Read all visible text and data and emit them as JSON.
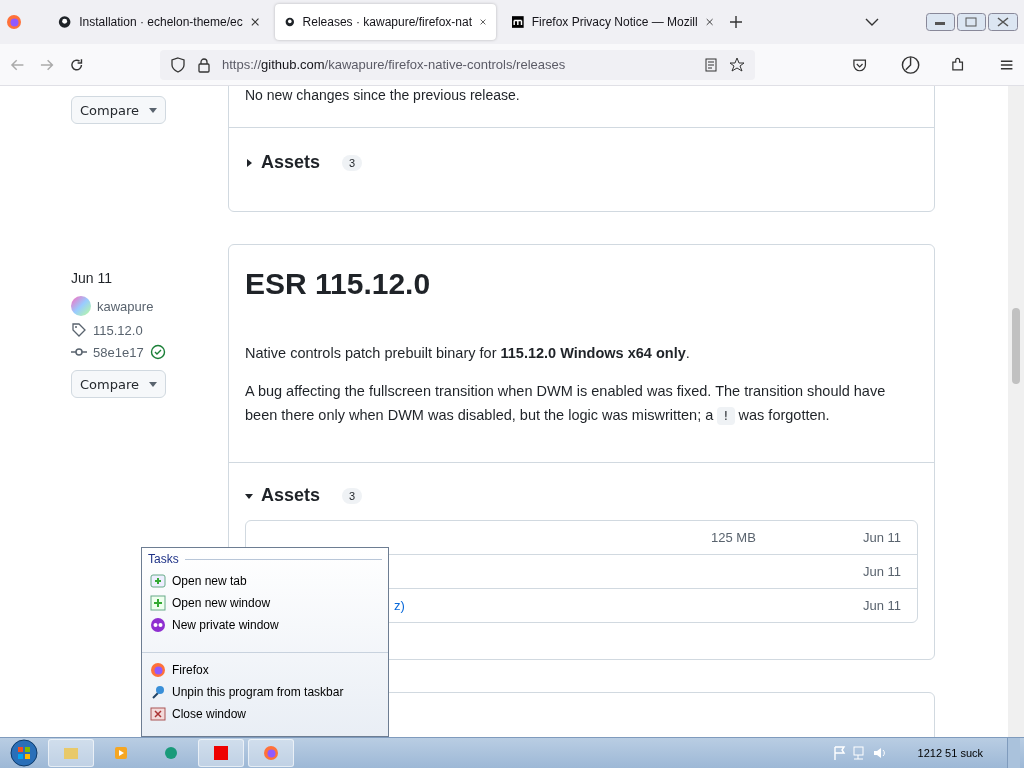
{
  "browser": {
    "tabs": [
      {
        "title": "Installation · echelon-theme/ec",
        "selected": false
      },
      {
        "title": "Releases · kawapure/firefox-nat",
        "selected": true
      },
      {
        "title": "Firefox Privacy Notice — Mozill",
        "selected": false
      }
    ],
    "url_prefix": "https://",
    "url_host": "github.com",
    "url_path": "/kawapure/firefox-native-controls/releases"
  },
  "releases": [
    {
      "compare": "Compare",
      "notes": "No new changes since the previous release.",
      "assets_label": "Assets",
      "assets_count": "3",
      "expanded": false
    },
    {
      "date": "Jun 11",
      "author": "kawapure",
      "tag": "115.12.0",
      "commit": "58e1e17",
      "verified": true,
      "compare": "Compare",
      "title": "ESR 115.12.0",
      "paragraphs": [
        "Native controls patch prebuilt binary for **115.12.0 Windows x64 only**."
      ],
      "bug_text_before": "A bug affecting the fullscreen transition when DWM is enabled was fixed. The transition should have been there only when DWM was disabled, but the logic was miswritten; a",
      "code": "!",
      "bug_text_after": "was forgotten.",
      "assets_label": "Assets",
      "assets_count": "3",
      "expanded": true,
      "assets": [
        {
          "size": "125 MB",
          "date": "Jun 11"
        },
        {
          "date": "Jun 11"
        },
        {
          "name": "z)",
          "date": "Jun 11"
        }
      ]
    }
  ],
  "jump_list": {
    "heading": "Tasks",
    "tasks": [
      {
        "label": "Open new tab"
      },
      {
        "label": "Open new window"
      },
      {
        "label": "New private window"
      }
    ],
    "items": [
      {
        "label": "Firefox"
      },
      {
        "label": "Unpin this program from taskbar"
      },
      {
        "label": "Close window"
      }
    ]
  },
  "taskbar": {
    "clock": "1212 51 suck"
  }
}
